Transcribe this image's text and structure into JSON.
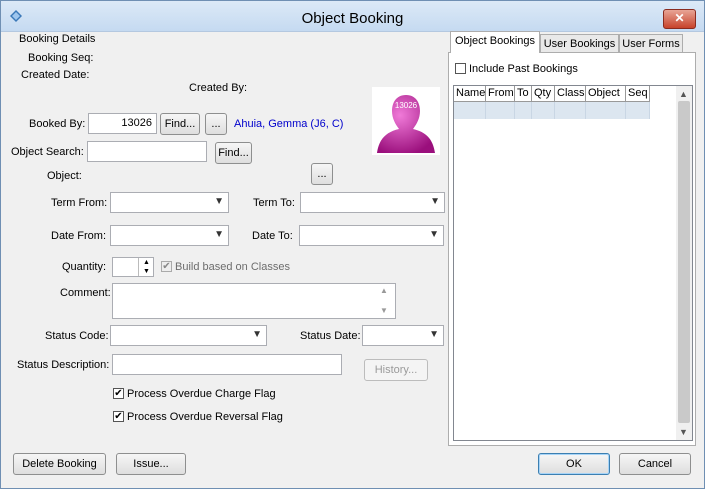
{
  "window": {
    "title": "Object Booking",
    "close_glyph": "✕"
  },
  "section_title": "Booking Details",
  "labels": {
    "booking_seq": "Booking Seq:",
    "created_date": "Created Date:",
    "created_by": "Created By:",
    "booked_by": "Booked By:",
    "object_search": "Object Search:",
    "object": "Object:",
    "term_from": "Term From:",
    "term_to": "Term To:",
    "date_from": "Date From:",
    "date_to": "Date To:",
    "quantity": "Quantity:",
    "build_based_on_classes": "Build based on Classes",
    "comment": "Comment:",
    "status_code": "Status Code:",
    "status_date": "Status Date:",
    "status_description": "Status Description:",
    "process_overdue_charge": "Process Overdue Charge Flag",
    "process_overdue_reversal": "Process Overdue Reversal Flag"
  },
  "values": {
    "booked_by": "13026",
    "booked_by_name": "Ahuia, Gemma (J6, C)",
    "avatar_badge": "13026"
  },
  "buttons": {
    "find": "Find...",
    "ellipsis": "...",
    "history": "History...",
    "delete_booking": "Delete Booking",
    "issue": "Issue...",
    "ok": "OK",
    "cancel": "Cancel"
  },
  "tabs": [
    {
      "label": "Object Bookings",
      "active": true
    },
    {
      "label": "User Bookings",
      "active": false
    },
    {
      "label": "User Forms",
      "active": false
    }
  ],
  "include_past_bookings": "Include Past Bookings",
  "grid_columns": [
    "Name",
    "From",
    "To",
    "Qty",
    "Class",
    "Object",
    "Seq"
  ],
  "checkboxes": {
    "build_based_on_classes": true,
    "process_overdue_charge": true,
    "process_overdue_reversal": true,
    "include_past_bookings": false
  },
  "icons": {
    "app": "app-logo-icon",
    "avatar": "user-silhouette-icon",
    "dropdown": "chevron-down-icon"
  },
  "colors": {
    "link": "#0000cc",
    "avatar": "#c2199f"
  }
}
